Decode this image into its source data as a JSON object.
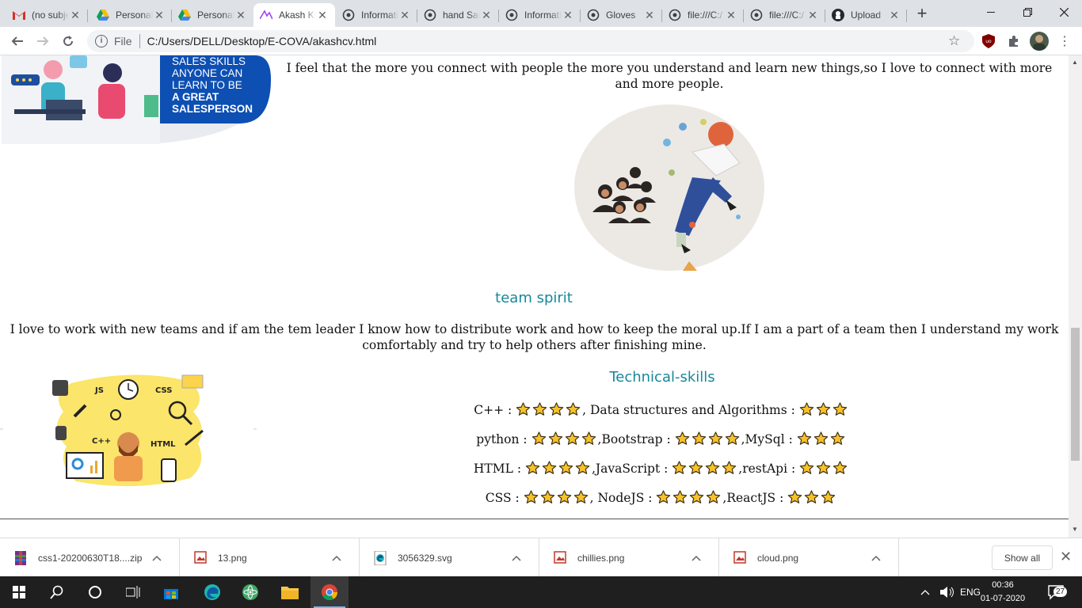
{
  "browser": {
    "tabs": [
      {
        "title": "(no subject)",
        "icon": "gmail-icon"
      },
      {
        "title": "Personal",
        "icon": "drive-icon"
      },
      {
        "title": "Personal",
        "icon": "drive-icon"
      },
      {
        "title": "Akash Kumar",
        "icon": "page-icon",
        "active": true
      },
      {
        "title": "Information",
        "icon": "globe-icon"
      },
      {
        "title": "hand Sanitizer",
        "icon": "globe-icon"
      },
      {
        "title": "Information",
        "icon": "globe-icon"
      },
      {
        "title": "Gloves",
        "icon": "globe-icon"
      },
      {
        "title": "file:///C:/",
        "icon": "globe-icon"
      },
      {
        "title": "file:///C:/",
        "icon": "globe-icon"
      },
      {
        "title": "Upload",
        "icon": "github-icon"
      }
    ],
    "new_tab_label": "+",
    "address": {
      "scheme_label": "File",
      "url": "C:/Users/DELL/Desktop/E-COVA/akashcv.html"
    }
  },
  "page": {
    "sales_banner_lines": [
      "SALES SKILLS",
      "ANYONE CAN",
      "LEARN TO BE",
      "A GREAT",
      "SALESPERSON"
    ],
    "connect_text": "I feel that the more you connect with people the more you understand and learn new things,so I love to connect with more and more people.",
    "team_title": "team spirit",
    "team_text": "I love to work with new teams and if am the tem leader I know how to distribute work and how to keep the moral up.If I am a part of a team then I understand my work comfortably and try to help others after finishing mine.",
    "tech_title": "Technical-skills",
    "tech_labels": [
      "JS",
      "CSS",
      "C++",
      "HTML"
    ],
    "skill_rows": [
      [
        {
          "label": "C++ : ",
          "stars": 4
        },
        {
          "label": ", Data structures and Algorithms : ",
          "stars": 3
        }
      ],
      [
        {
          "label": "python : ",
          "stars": 4
        },
        {
          "label": ",Bootstrap : ",
          "stars": 4
        },
        {
          "label": ",MySql : ",
          "stars": 3
        }
      ],
      [
        {
          "label": "HTML : ",
          "stars": 4
        },
        {
          "label": ",JavaScript : ",
          "stars": 4
        },
        {
          "label": ",restApi : ",
          "stars": 3
        }
      ],
      [
        {
          "label": "CSS : ",
          "stars": 4
        },
        {
          "label": ", NodeJS : ",
          "stars": 4
        },
        {
          "label": ",ReactJS : ",
          "stars": 3
        }
      ]
    ]
  },
  "downloads": {
    "items": [
      {
        "name": "css1-20200630T18....zip",
        "icon": "archive-icon"
      },
      {
        "name": "13.png",
        "icon": "image-file-icon"
      },
      {
        "name": "3056329.svg",
        "icon": "edge-file-icon"
      },
      {
        "name": "chillies.png",
        "icon": "image-file-icon"
      },
      {
        "name": "cloud.png",
        "icon": "image-file-icon"
      }
    ],
    "show_all_label": "Show all"
  },
  "taskbar": {
    "language": "ENG",
    "time": "00:36",
    "date": "01-07-2020",
    "notification_count": "27"
  },
  "colors": {
    "accent_teal": "#17879a",
    "star_fill": "#f6c22b",
    "banner_blue": "#0d4fb3"
  }
}
